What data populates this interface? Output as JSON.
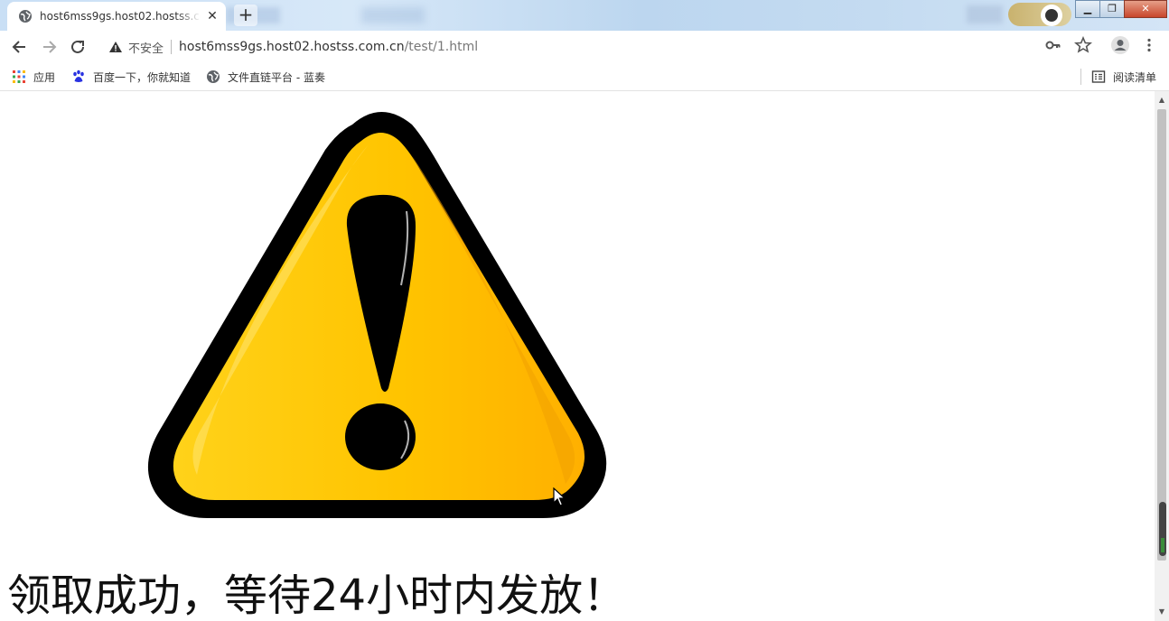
{
  "tab": {
    "title": "host6mss9gs.host02.hostss.com.cn/test/1.html"
  },
  "toolbar": {
    "security_label": "不安全",
    "url_host": "host6mss9gs.host02.hostss.com.cn",
    "url_path": "/test/1.html"
  },
  "bookmarks": {
    "items": [
      {
        "label": "应用",
        "icon": "apps-grid-icon"
      },
      {
        "label": "百度一下，你就知道",
        "icon": "baidu-paw-icon"
      },
      {
        "label": "文件直链平台 - 蓝奏",
        "icon": "globe-icon"
      }
    ],
    "reading_list_label": "阅读清单"
  },
  "page": {
    "message": "领取成功，等待24小时内发放！",
    "graphic": "warning-triangle-exclamation"
  },
  "colors": {
    "warning_yellow": "#FFC000",
    "warning_outline": "#000000",
    "close_button": "#C8462B"
  }
}
